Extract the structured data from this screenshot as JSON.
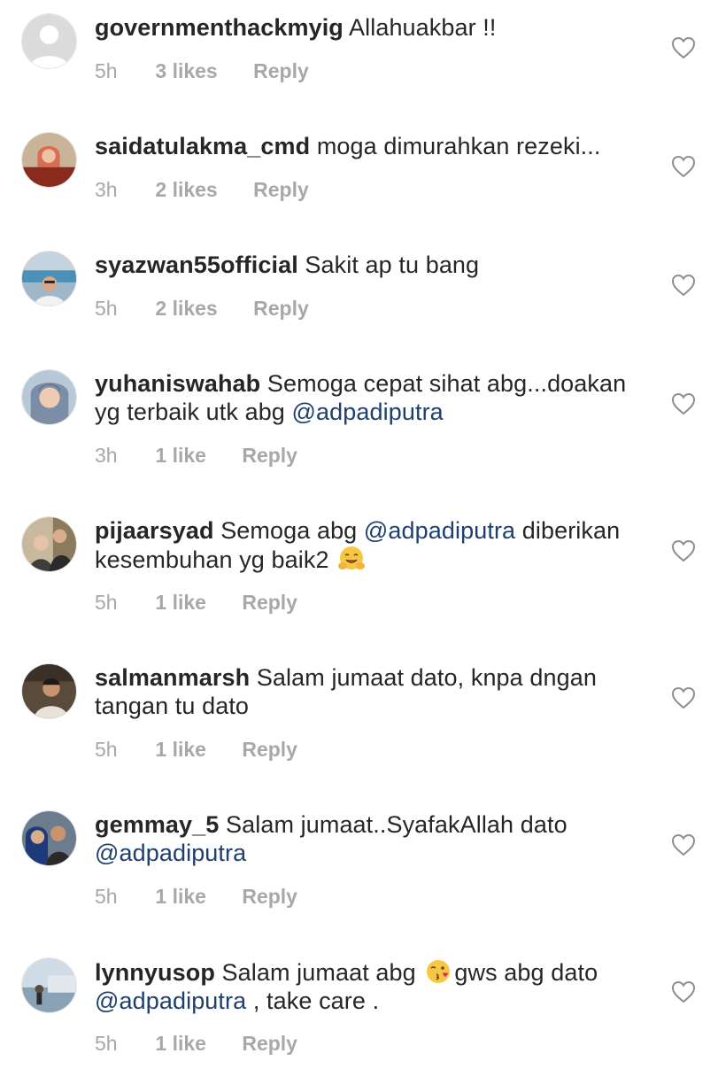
{
  "comments": [
    {
      "username": "governmenthackmyig",
      "text_before": "Allahuakbar !!",
      "mention": "",
      "text_after": "",
      "text_line2": "",
      "time": "5h",
      "likes": "3 likes",
      "reply": "Reply",
      "avatar": "default-avatar-icon"
    },
    {
      "username": "saidatulakma_cmd",
      "text_before": "moga dimurahkan rezeki...",
      "mention": "",
      "time": "3h",
      "likes": "2 likes",
      "reply": "Reply",
      "avatar": "user-photo"
    },
    {
      "username": "syazwan55official",
      "text_before": "Sakit ap tu bang",
      "mention": "",
      "time": "5h",
      "likes": "2 likes",
      "reply": "Reply",
      "avatar": "user-photo"
    },
    {
      "username": "yuhaniswahab",
      "text_before": "Semoga cepat sihat abg...doakan yg terbaik utk abg",
      "mention": "@adpadiputra",
      "time": "3h",
      "likes": "1 like",
      "reply": "Reply",
      "avatar": "user-photo"
    },
    {
      "username": "pijaarsyad",
      "text_before": "Semoga abg",
      "mention": "@adpadiputra",
      "text_after": "diberikan kesembuhan yg baik2",
      "emoji": "hugging-face-emoji",
      "time": "5h",
      "likes": "1 like",
      "reply": "Reply",
      "avatar": "user-photo"
    },
    {
      "username": "salmanmarsh",
      "text_before": "Salam jumaat dato, knpa dngan tangan tu dato",
      "mention": "",
      "time": "5h",
      "likes": "1 like",
      "reply": "Reply",
      "avatar": "user-photo"
    },
    {
      "username": "gemmay_5",
      "text_before": "Salam jumaat..SyafakAllah dato",
      "mention": "@adpadiputra",
      "time": "5h",
      "likes": "1 like",
      "reply": "Reply",
      "avatar": "user-photo"
    },
    {
      "username": "lynnyusop",
      "text_before": "Salam jumaat abg",
      "emoji": "face-blowing-kiss-emoji",
      "text_after": "gws abg dato",
      "mention": "@adpadiputra",
      "text_end": ", take care .",
      "time": "5h",
      "likes": "1 like",
      "reply": "Reply",
      "avatar": "user-photo"
    }
  ],
  "colors": {
    "username": "#262626",
    "mention": "#1f3f6d",
    "meta": "#a8a8a8",
    "heart_stroke": "#8e8e8e"
  },
  "icons": {
    "like": "heart-outline-icon"
  }
}
